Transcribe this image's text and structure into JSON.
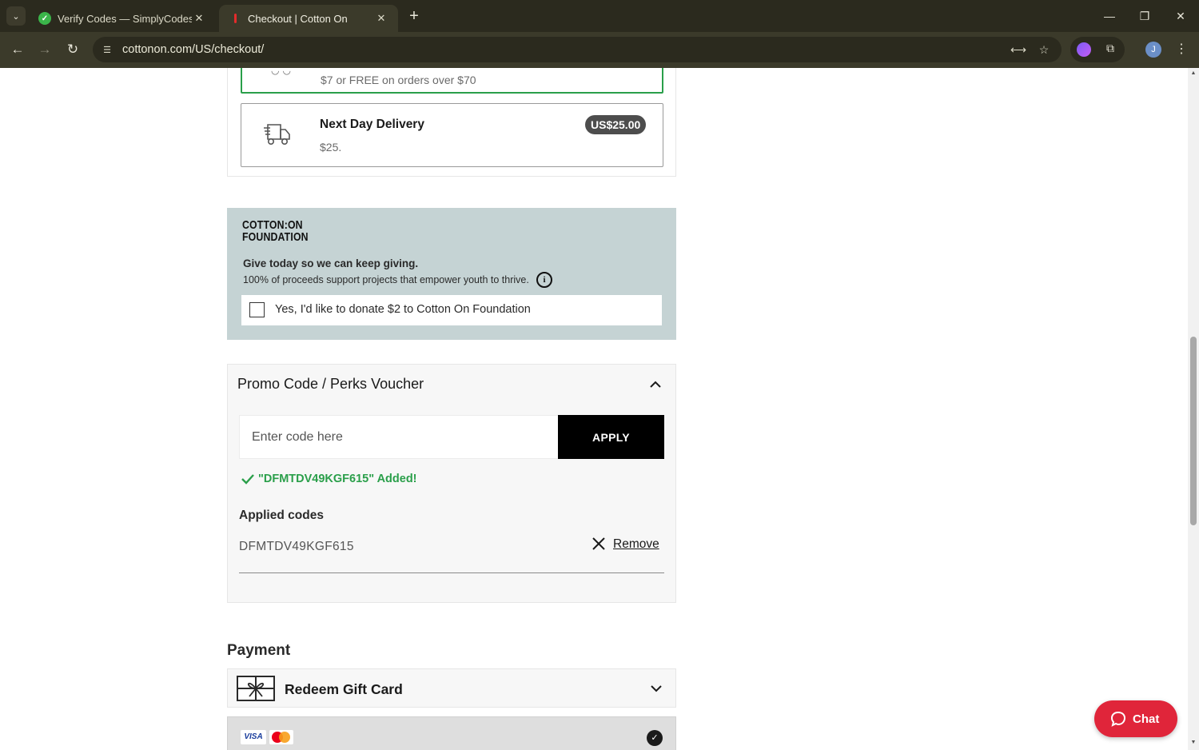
{
  "browser": {
    "tabs": [
      {
        "title": "Verify Codes — SimplyCodes",
        "active": false
      },
      {
        "title": "Checkout | Cotton On",
        "active": true
      }
    ],
    "url": "cottonon.com/US/checkout/",
    "profile_initial": "J"
  },
  "shipping": {
    "selected_option_desc": "$7 or FREE on orders over $70",
    "next_day": {
      "name": "Next Day Delivery",
      "price_desc": "$25.",
      "badge": "US$25.00"
    }
  },
  "foundation": {
    "logo_line1": "COTTON:ON",
    "logo_line2": "FOUNDATION",
    "headline": "Give today so we can keep giving.",
    "subtext": "100% of proceeds support projects that empower youth to thrive.",
    "donate_label": "Yes, I'd like to donate $2 to Cotton On Foundation",
    "donate_checked": false
  },
  "promo": {
    "title": "Promo Code / Perks Voucher",
    "input_placeholder": "Enter code here",
    "input_value": "",
    "apply_label": "APPLY",
    "success_message": "\"DFMTDV49KGF615\" Added!",
    "applied_heading": "Applied codes",
    "applied_code": "DFMTDV49KGF615",
    "remove_label": "Remove"
  },
  "payment": {
    "heading": "Payment",
    "gift_card_label": "Redeem Gift Card",
    "card_brand": "VISA"
  },
  "chat": {
    "label": "Chat"
  },
  "colors": {
    "success_green": "#2a9f4a",
    "foundation_bg": "#c5d3d4",
    "chat_red": "#e0253a",
    "apply_bg": "#000000"
  }
}
